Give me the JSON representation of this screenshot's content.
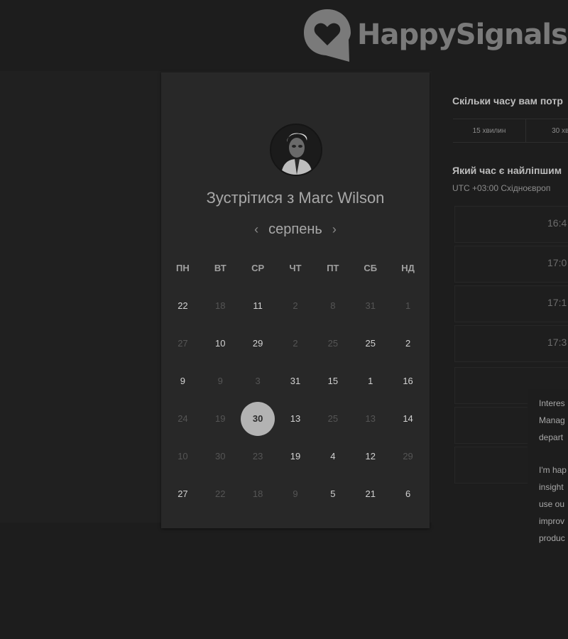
{
  "brand": {
    "name": "HappySignals"
  },
  "booking": {
    "title": "Зустрітися з Marc Wilson",
    "month": "серпень",
    "prev_icon": "‹",
    "next_icon": "›",
    "weekdays": [
      "ПН",
      "ВТ",
      "СР",
      "ЧТ",
      "ПТ",
      "СБ",
      "НД"
    ],
    "days": [
      {
        "label": "22",
        "muted": false
      },
      {
        "label": "18",
        "muted": true
      },
      {
        "label": "11",
        "muted": false
      },
      {
        "label": "2",
        "muted": true
      },
      {
        "label": "8",
        "muted": true
      },
      {
        "label": "31",
        "muted": true
      },
      {
        "label": "1",
        "muted": true
      },
      {
        "label": "27",
        "muted": true
      },
      {
        "label": "10",
        "muted": false
      },
      {
        "label": "29",
        "muted": false
      },
      {
        "label": "2",
        "muted": true
      },
      {
        "label": "25",
        "muted": true
      },
      {
        "label": "25",
        "muted": false
      },
      {
        "label": "2",
        "muted": false
      },
      {
        "label": "9",
        "muted": false
      },
      {
        "label": "9",
        "muted": true
      },
      {
        "label": "3",
        "muted": true
      },
      {
        "label": "31",
        "muted": false
      },
      {
        "label": "15",
        "muted": false
      },
      {
        "label": "1",
        "muted": false
      },
      {
        "label": "16",
        "muted": false
      },
      {
        "label": "24",
        "muted": true
      },
      {
        "label": "19",
        "muted": true
      },
      {
        "label": "30",
        "muted": false,
        "selected": true
      },
      {
        "label": "13",
        "muted": false
      },
      {
        "label": "25",
        "muted": true
      },
      {
        "label": "13",
        "muted": true
      },
      {
        "label": "14",
        "muted": false
      },
      {
        "label": "10",
        "muted": true
      },
      {
        "label": "30",
        "muted": true
      },
      {
        "label": "23",
        "muted": true
      },
      {
        "label": "19",
        "muted": false
      },
      {
        "label": "4",
        "muted": false
      },
      {
        "label": "12",
        "muted": false
      },
      {
        "label": "29",
        "muted": true
      },
      {
        "label": "27",
        "muted": false
      },
      {
        "label": "22",
        "muted": true
      },
      {
        "label": "18",
        "muted": true
      },
      {
        "label": "9",
        "muted": true
      },
      {
        "label": "5",
        "muted": false
      },
      {
        "label": "21",
        "muted": false
      },
      {
        "label": "6",
        "muted": false
      }
    ]
  },
  "duration": {
    "question": "Скільки часу вам потр",
    "options": [
      "15 хвилин",
      "30 хви"
    ]
  },
  "timeslots": {
    "question": "Який час є найліпшим",
    "timezone": "UTC +03:00 Східноєвроп",
    "slots": [
      "16:4",
      "17:0",
      "17:1",
      "17:3",
      "",
      "",
      ""
    ]
  },
  "message": {
    "lines1": [
      "Interes",
      "Manag",
      "depart"
    ],
    "lines2": [
      "I'm hap",
      "insight",
      "use ou",
      "improv",
      "produc"
    ]
  },
  "colors": {
    "background": "#1d1d1d",
    "card": "#282828",
    "selected_day": "#b3b3b3",
    "logo": "#7a7a7a"
  }
}
